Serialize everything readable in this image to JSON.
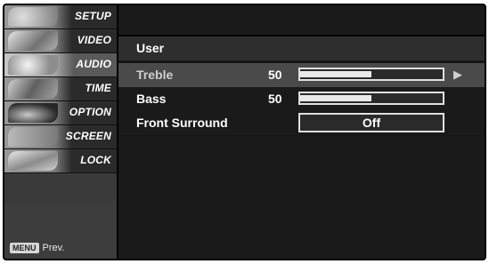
{
  "menu": {
    "items": [
      {
        "label": "SETUP",
        "icon": "setup-icon"
      },
      {
        "label": "VIDEO",
        "icon": "video-icon"
      },
      {
        "label": "AUDIO",
        "icon": "audio-icon"
      },
      {
        "label": "TIME",
        "icon": "time-icon"
      },
      {
        "label": "OPTION",
        "icon": "option-icon"
      },
      {
        "label": "SCREEN",
        "icon": "screen-icon"
      },
      {
        "label": "LOCK",
        "icon": "lock-icon"
      }
    ],
    "active": "AUDIO"
  },
  "footer": {
    "key_label": "MENU",
    "prev_label": "Prev."
  },
  "audio": {
    "mode_label": "User",
    "treble": {
      "label": "Treble",
      "value": "50",
      "level": 0.5
    },
    "bass": {
      "label": "Bass",
      "value": "50",
      "level": 0.5
    },
    "front_surround": {
      "label": "Front Surround",
      "value": "Off"
    },
    "submenu_arrow": "▶"
  },
  "colors": {
    "accent": "#e9e9e9",
    "background": "#1a1a1a"
  }
}
